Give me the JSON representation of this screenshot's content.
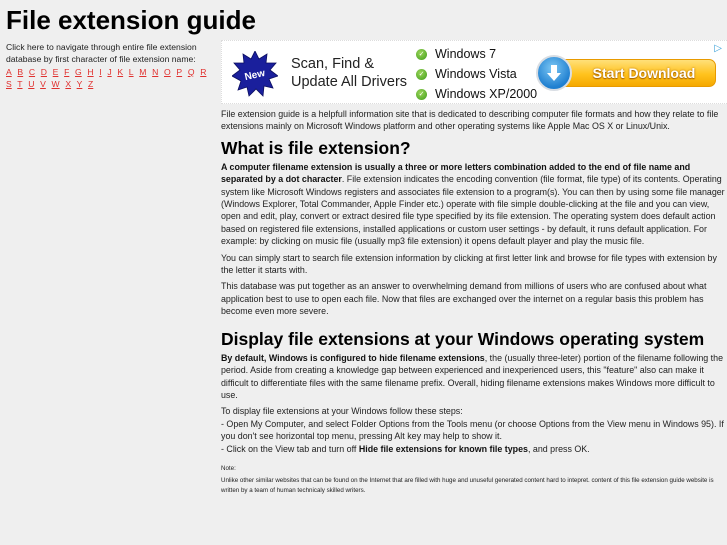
{
  "header": {
    "title": "File extension guide"
  },
  "left_nav": {
    "intro": "Click here to navigate through entire file extension database by first character of file extension name:",
    "letters": [
      "A",
      "B",
      "C",
      "D",
      "E",
      "F",
      "G",
      "H",
      "I",
      "J",
      "K",
      "L",
      "M",
      "N",
      "O",
      "P",
      "Q",
      "R",
      "S",
      "T",
      "U",
      "V",
      "W",
      "X",
      "Y",
      "Z"
    ],
    "link_color": "#e0302e"
  },
  "ad": {
    "badge_label": "New",
    "headline_line1": "Scan, Find &",
    "headline_line2": "Update All Drivers",
    "os_list": [
      "Windows 7",
      "Windows Vista",
      "Windows XP/2000"
    ],
    "button_label": "Start Download",
    "ad_choices_icon": "ad-choices-triangle-icon"
  },
  "main": {
    "intro": "File extension guide is a helpfull information site that is dedicated to describing computer file formats and how they relate to file extensions mainly on Microsoft Windows platform and other operating systems like Apple Mac OS X or Linux/Unix.",
    "section1": {
      "heading": "What is file extension?",
      "p1_bold": "A computer filename extension is usually a three or more letters combination added to the end of file name and separated by a dot character",
      "p1_rest": ". File extension indicates the encoding convention (file format, file type) of its contents. Operating system like Microsoft Windows registers and associates file extension to a program(s). You can then by using some file manager (Windows Explorer, Total Commander, Apple Finder etc.) operate with file simple double-clicking at the file and you can view, open and edit, play, convert or extract desired file type specified by its file extension. The operating system does default action based on registered file extensions, installed applications or custom user settings - by default, it runs default application. For example: by clicking on music file (usually mp3 file extension) it opens default player and play the music file.",
      "p2": "You can simply start to search file extension information by clicking at first letter link and browse for file types with extension by the letter it starts with.",
      "p3": "This database was put together as an answer to overwhelming demand from millions of users who are confused about what application best to use to open each file. Now that files are exchanged over the internet on a regular basis this problem has become even more severe."
    },
    "section2": {
      "heading": "Display file extensions at your Windows operating system",
      "p1_bold": "By default, Windows is configured to hide filename extensions",
      "p1_rest": ", the (usually three-leter) portion of the filename following the period. Aside from creating a knowledge gap between experienced and inexperienced users, this \"feature\" also can make it difficult to differentiate files with the same filename prefix. Overall, hiding filename extensions makes Windows more difficult to use.",
      "steps_intro": "To display file extensions at your Windows follow these steps:",
      "step1": "- Open My Computer, and select Folder Options from the Tools menu (or choose Options from the View menu in Windows 95). If you don't see horizontal top menu, pressing Alt key may help to show it.",
      "step2_pre": "- Click on the View tab and turn off ",
      "step2_bold": "Hide file extensions for known file types",
      "step2_post": ", and press OK."
    },
    "note": {
      "label": "Note:",
      "text": "Unlike other similar websites that can be found on the Internet that are filled with huge and unuseful generated content hard to intepret. content of this file extension guide website is written by a team of human technicaly skilled writers."
    }
  }
}
